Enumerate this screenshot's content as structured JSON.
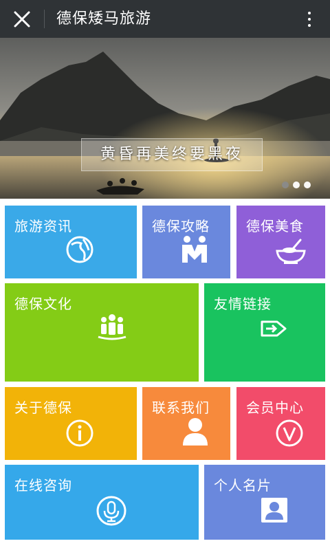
{
  "header": {
    "title": "德保矮马旅游",
    "close_icon": "close-icon",
    "more_icon": "more-vertical-icon"
  },
  "banner": {
    "caption": "黄昏再美终要黑夜",
    "slide_count": 3,
    "active_slide": 2
  },
  "tiles": [
    {
      "label": "旅游资讯",
      "icon": "globe-icon",
      "color": "#3aa9e8"
    },
    {
      "label": "德保攻略",
      "icon": "people-guide-icon",
      "color": "#6a88dd"
    },
    {
      "label": "德保美食",
      "icon": "food-bowl-icon",
      "color": "#8f5fd8"
    },
    {
      "label": "德保文化",
      "icon": "group-people-icon",
      "color": "#84cc16"
    },
    {
      "label": "友情链接",
      "icon": "link-arrow-icon",
      "color": "#19c35f"
    },
    {
      "label": "关于德保",
      "icon": "info-icon",
      "color": "#f2b308"
    },
    {
      "label": "联系我们",
      "icon": "user-icon",
      "color": "#f78a3c"
    },
    {
      "label": "会员中心",
      "icon": "vip-icon",
      "color": "#f24c6a"
    },
    {
      "label": "在线咨询",
      "icon": "microphone-icon",
      "color": "#35a8ea"
    },
    {
      "label": "个人名片",
      "icon": "contact-card-icon",
      "color": "#6a88dd"
    }
  ]
}
